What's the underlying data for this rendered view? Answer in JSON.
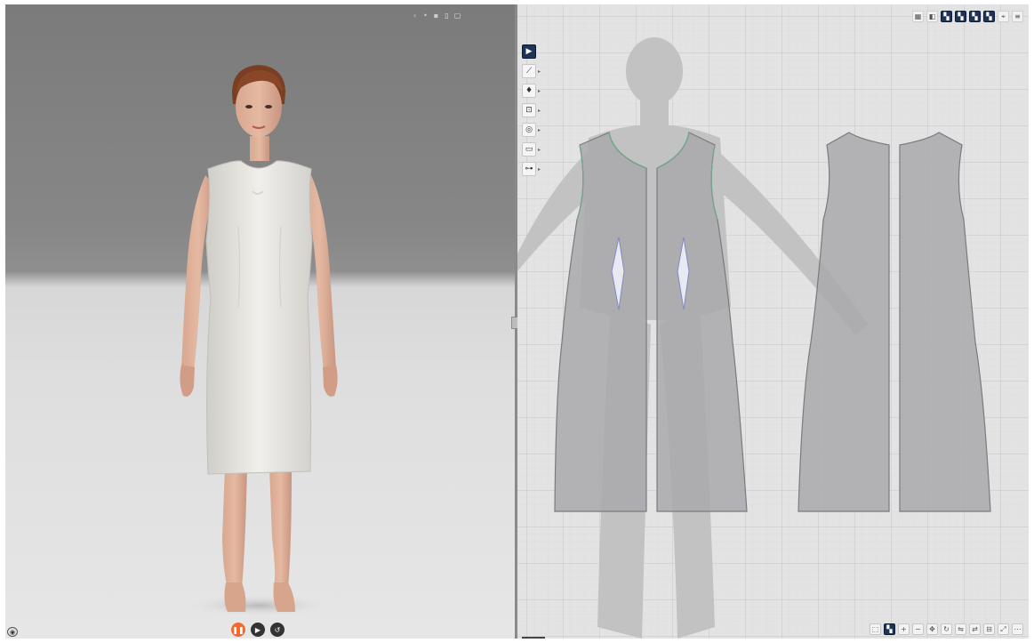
{
  "app": {
    "title": ""
  },
  "viewport3d": {
    "toolbar": {
      "icons": [
        "arrow-icon",
        "avatar-toggle-icon",
        "marker-icon",
        "garment-icon",
        "camera-icon"
      ]
    },
    "playback": {
      "icons": [
        "pause-icon",
        "play-icon",
        "reset-icon"
      ],
      "accent": "#f26a2e"
    }
  },
  "viewport2d": {
    "toolbar_top": {
      "icons": [
        "grid-icon",
        "layer-icon",
        "layout-a-icon",
        "layout-b-icon",
        "layout-c-icon",
        "layout-d-icon",
        "pin-icon",
        "settings-icon"
      ]
    },
    "side_tools": [
      {
        "name": "select-tool",
        "icon": "cursor-icon",
        "active": true
      },
      {
        "name": "line-tool",
        "icon": "pen-icon",
        "active": false
      },
      {
        "name": "dart-tool",
        "icon": "dart-icon",
        "active": false
      },
      {
        "name": "seam-tool",
        "icon": "seam-icon",
        "active": false
      },
      {
        "name": "button-tool",
        "icon": "circle-icon",
        "active": false
      },
      {
        "name": "fold-tool",
        "icon": "fold-icon",
        "active": false
      },
      {
        "name": "measure-tool",
        "icon": "measure-icon",
        "active": false
      }
    ],
    "bottom_bar": {
      "icons": [
        "fit-icon",
        "view-icon",
        "zoom-in-icon",
        "zoom-out-icon",
        "pan-icon",
        "rotate-icon",
        "flip-icon",
        "mirror-icon",
        "align-icon",
        "expand-icon",
        "more-icon"
      ]
    },
    "colors": {
      "selected_accent": "#1d3456",
      "panel_fill": "#a9a9ab",
      "panel_stroke": "#7a7a80",
      "seam_green": "#6fa88a",
      "dart_blue": "#7f8bbd"
    }
  }
}
